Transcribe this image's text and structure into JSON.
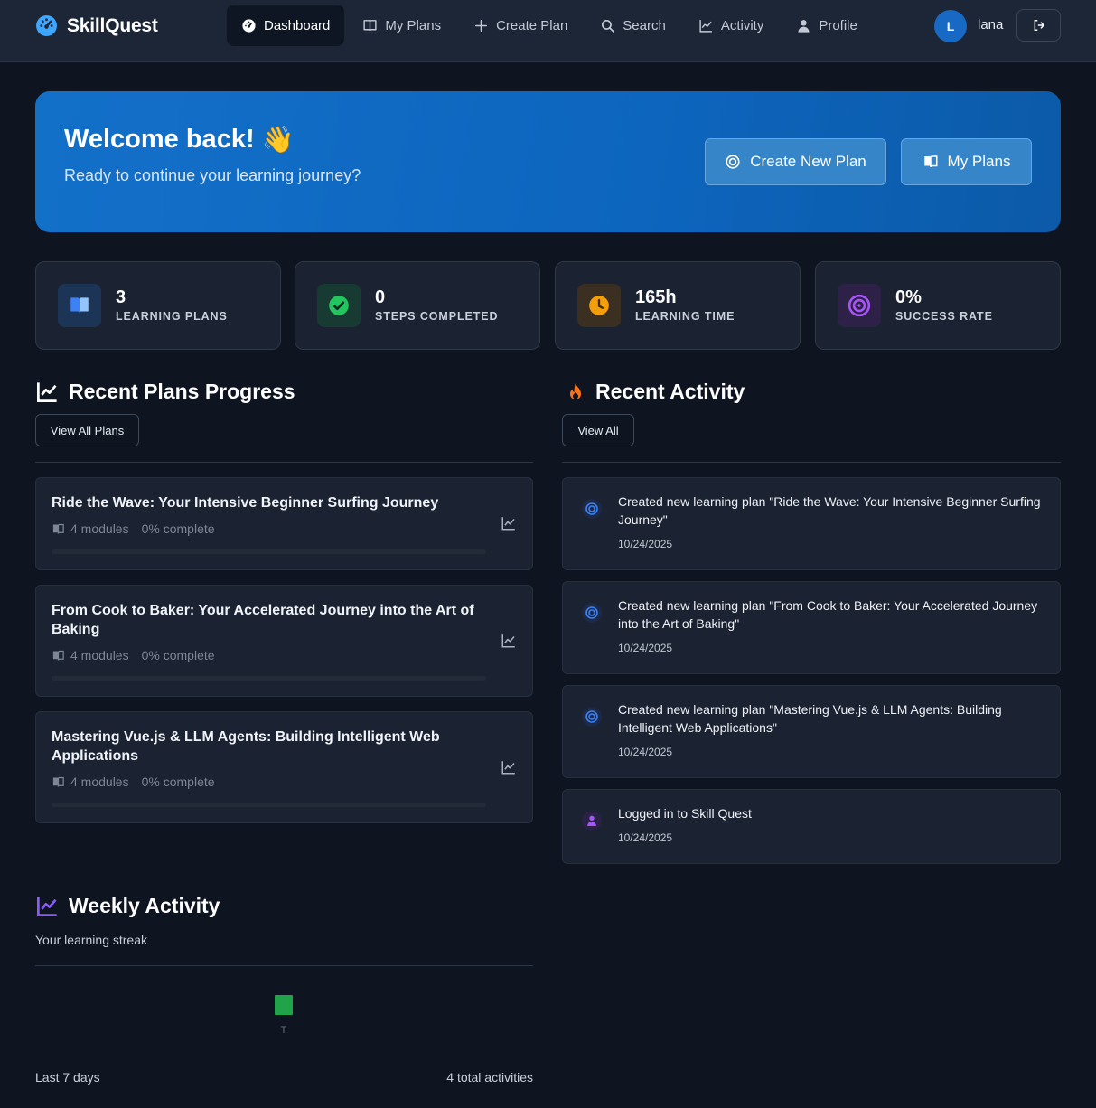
{
  "nav": {
    "brand": "SkillQuest",
    "items": [
      {
        "label": "Dashboard",
        "icon": "dashboard-icon",
        "active": true
      },
      {
        "label": "My Plans",
        "icon": "book-icon"
      },
      {
        "label": "Create Plan",
        "icon": "plus-icon"
      },
      {
        "label": "Search",
        "icon": "search-icon"
      },
      {
        "label": "Activity",
        "icon": "chart-line-icon"
      },
      {
        "label": "Profile",
        "icon": "user-icon"
      }
    ],
    "avatar_initial": "L",
    "username": "lana"
  },
  "hero": {
    "title": "Welcome back!",
    "emoji": "👋",
    "subtitle": "Ready to continue your learning journey?",
    "create_label": "Create New Plan",
    "plans_label": "My Plans"
  },
  "stats": [
    {
      "value": "3",
      "label": "LEARNING PLANS",
      "color": "#3b82f6"
    },
    {
      "value": "0",
      "label": "STEPS COMPLETED",
      "color": "#22c55e"
    },
    {
      "value": "165h",
      "label": "LEARNING TIME",
      "color": "#f59e0b"
    },
    {
      "value": "0%",
      "label": "SUCCESS RATE",
      "color": "#a855f7"
    }
  ],
  "recent_plans": {
    "title": "Recent Plans Progress",
    "view_all": "View All Plans",
    "items": [
      {
        "title": "Ride the Wave: Your Intensive Beginner Surfing Journey",
        "modules": "4 modules",
        "progress": "0% complete",
        "progress_value": 0
      },
      {
        "title": "From Cook to Baker: Your Accelerated Journey into the Art of Baking",
        "modules": "4 modules",
        "progress": "0% complete",
        "progress_value": 0
      },
      {
        "title": "Mastering Vue.js & LLM Agents: Building Intelligent Web Applications",
        "modules": "4 modules",
        "progress": "0% complete",
        "progress_value": 0
      }
    ]
  },
  "recent_activity": {
    "title": "Recent Activity",
    "view_all": "View All",
    "items": [
      {
        "text": "Created new learning plan \"Ride the Wave: Your Intensive Beginner Surfing Journey\"",
        "date": "10/24/2025",
        "icon": "target-icon"
      },
      {
        "text": "Created new learning plan \"From Cook to Baker: Your Accelerated Journey into the Art of Baking\"",
        "date": "10/24/2025",
        "icon": "target-icon"
      },
      {
        "text": "Created new learning plan \"Mastering Vue.js & LLM Agents: Building Intelligent Web Applications\"",
        "date": "10/24/2025",
        "icon": "target-icon"
      },
      {
        "text": "Logged in to Skill Quest",
        "date": "10/24/2025",
        "icon": "user-icon"
      }
    ]
  },
  "weekly": {
    "title": "Weekly Activity",
    "subtitle": "Your learning streak",
    "day_label": "T",
    "period": "Last 7 days",
    "total": "4 total activities"
  }
}
